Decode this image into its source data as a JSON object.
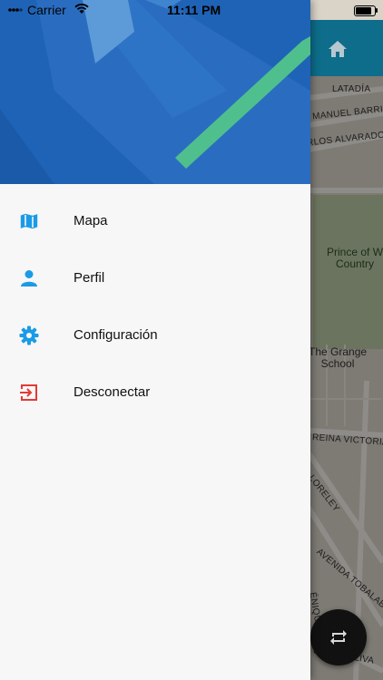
{
  "status_bar": {
    "carrier": "Carrier",
    "time": "11:11 PM"
  },
  "map": {
    "streets": [
      "LATADÍA",
      "MANUEL BARRIO",
      "RLOS ALVARADO",
      "REINA VICTORIA",
      "LORELEY",
      "AVENIDA TOBALAB",
      "ÉNIQUE",
      "JOSÉ BOLIVA"
    ],
    "places": [
      "Prince of W",
      "Country",
      "The Grange",
      "School"
    ]
  },
  "menu": {
    "items": [
      {
        "label": "Mapa",
        "icon": "map-icon"
      },
      {
        "label": "Perfil",
        "icon": "person-icon"
      },
      {
        "label": "Configuración",
        "icon": "gear-icon"
      },
      {
        "label": "Desconectar",
        "icon": "logout-icon"
      }
    ]
  },
  "colors": {
    "header_blue": "#1f63b6",
    "accent_green": "#4fc08d",
    "icon_blue": "#1a9be6",
    "logout_red": "#e53935",
    "map_header": "#0d6d8a"
  }
}
